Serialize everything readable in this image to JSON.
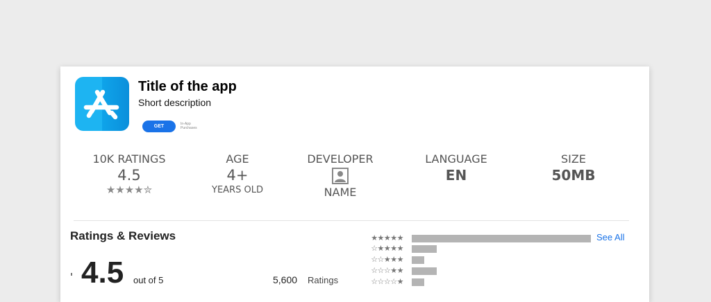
{
  "app": {
    "title": "Title of the app",
    "description": "Short description",
    "get_label": "GET",
    "iap_note": "In-App Purchases",
    "icon": "app-store-icon",
    "icon_colors": [
      "#1db4f2",
      "#0b8fdb"
    ]
  },
  "stats": {
    "ratings": {
      "label": "10K RATINGS",
      "value": "4.5",
      "stars": "★★★★✮"
    },
    "age": {
      "label": "AGE",
      "value": "4+",
      "sub": "YEARS OLD"
    },
    "developer": {
      "label": "DEVELOPER",
      "icon": "person-icon",
      "name": "NAME"
    },
    "language": {
      "label": "LANGUAGE",
      "value": "EN"
    },
    "size": {
      "label": "SIZE",
      "value": "50MB"
    }
  },
  "reviews": {
    "title": "Ratings & Reviews",
    "score": "4.5",
    "out_of": "out of 5",
    "count": "5,600",
    "count_label": "Ratings",
    "see_all": "See All",
    "breakdown": [
      {
        "stars": "★★★★★",
        "fraction": 1.0
      },
      {
        "stars": "☆★★★★",
        "fraction": 0.14
      },
      {
        "stars": "☆☆★★★",
        "fraction": 0.07
      },
      {
        "stars": "☆☆☆★★",
        "fraction": 0.14
      },
      {
        "stars": "☆☆☆☆★",
        "fraction": 0.07
      }
    ],
    "bar_color": "#b4b4b4",
    "link_color": "#1a73e8"
  }
}
